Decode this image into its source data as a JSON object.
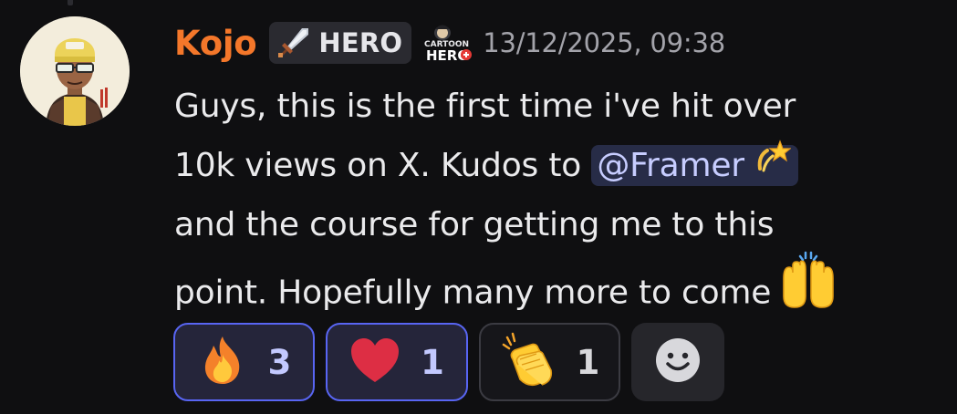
{
  "message": {
    "author": "Kojo",
    "tag": {
      "label": "HERO",
      "icon": "sword-icon"
    },
    "guild_badge": {
      "line1": "CARTOON",
      "line2": "HERO"
    },
    "timestamp": "13/12/2025, 09:38",
    "content": {
      "line1": "Guys, this is the first time i've hit over",
      "line2_prefix": "10k views on X. Kudos to ",
      "mention": "@Framer",
      "line3": "and the course for getting me to this",
      "line4": "point. Hopefully many more to come"
    }
  },
  "reactions": [
    {
      "emoji": "fire-emoji",
      "count": "3",
      "selected": true
    },
    {
      "emoji": "red-heart-emoji",
      "count": "1",
      "selected": true
    },
    {
      "emoji": "clapping-hands-emoji",
      "count": "1",
      "selected": false
    }
  ],
  "colors": {
    "username": "#f4772a",
    "mention_bg": "#272c47",
    "reaction_selected_border": "#5865f2",
    "background": "#0f0f11"
  }
}
